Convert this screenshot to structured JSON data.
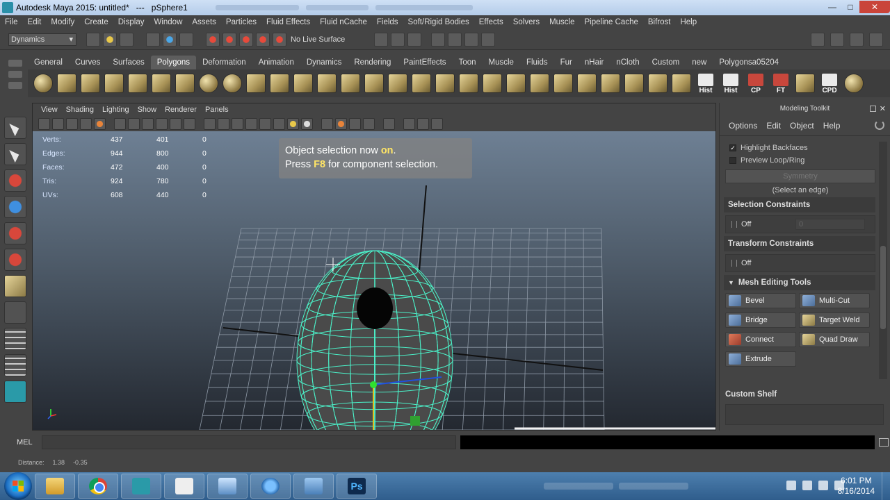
{
  "window": {
    "title": "Autodesk Maya 2015: untitled*   ---   pSphere1",
    "minimize": "—",
    "maximize": "□",
    "close": "✕"
  },
  "menubar": [
    "File",
    "Edit",
    "Modify",
    "Create",
    "Display",
    "Window",
    "Assets",
    "Particles",
    "Fluid Effects",
    "Fluid nCache",
    "Fields",
    "Soft/Rigid Bodies",
    "Effects",
    "Solvers",
    "Muscle",
    "Pipeline Cache",
    "Bifrost",
    "Help"
  ],
  "statusline": {
    "mode": "Dynamics",
    "live_surface": "No Live Surface"
  },
  "shelf": {
    "tabs": [
      "General",
      "Curves",
      "Surfaces",
      "Polygons",
      "Deformation",
      "Animation",
      "Dynamics",
      "Rendering",
      "PaintEffects",
      "Toon",
      "Muscle",
      "Fluids",
      "Fur",
      "nHair",
      "nCloth",
      "Custom",
      "new",
      "Polygonsa05204"
    ],
    "active_tab": "Polygons",
    "text_buttons": [
      "Hist",
      "Hist",
      "CP",
      "FT",
      "",
      "CPD"
    ]
  },
  "viewport": {
    "menu": [
      "View",
      "Shading",
      "Lighting",
      "Show",
      "Renderer",
      "Panels"
    ],
    "hud": [
      {
        "label": "Verts:",
        "a": "437",
        "b": "401",
        "c": "0"
      },
      {
        "label": "Edges:",
        "a": "944",
        "b": "800",
        "c": "0"
      },
      {
        "label": "Faces:",
        "a": "472",
        "b": "400",
        "c": "0"
      },
      {
        "label": "Tris:",
        "a": "924",
        "b": "780",
        "c": "0"
      },
      {
        "label": "UVs:",
        "a": "608",
        "b": "440",
        "c": "0"
      }
    ],
    "notification": {
      "line1_pre": "Object selection now ",
      "line1_hl": "on",
      "line1_post": ".",
      "line2_pre": "Press ",
      "line2_hl": "F8",
      "line2_post": " for component selection."
    }
  },
  "command_line": {
    "label": "MEL"
  },
  "help_line": {
    "label": "Distance:",
    "v1": "1.38",
    "v2": "-0.35"
  },
  "modeling_toolkit": {
    "title": "Modeling Toolkit",
    "menu": [
      "Options",
      "Edit",
      "Object",
      "Help"
    ],
    "highlight_backfaces": "Highlight Backfaces",
    "preview_loop": "Preview Loop/Ring",
    "symmetry": "Symmetry",
    "select_edge_hint": "(Select an edge)",
    "selection_constraints": {
      "title": "Selection Constraints",
      "value": "Off",
      "field": "0"
    },
    "transform_constraints": {
      "title": "Transform Constraints",
      "value": "Off"
    },
    "mesh_editing": {
      "title": "Mesh Editing Tools",
      "tools": [
        "Bevel",
        "Multi-Cut",
        "Bridge",
        "Target Weld",
        "Connect",
        "Quad Draw",
        "Extrude"
      ]
    },
    "custom_shelf": "Custom Shelf"
  },
  "taskbar": {
    "time": "6:01 PM",
    "date": "8/16/2014",
    "ps_label": "Ps"
  }
}
